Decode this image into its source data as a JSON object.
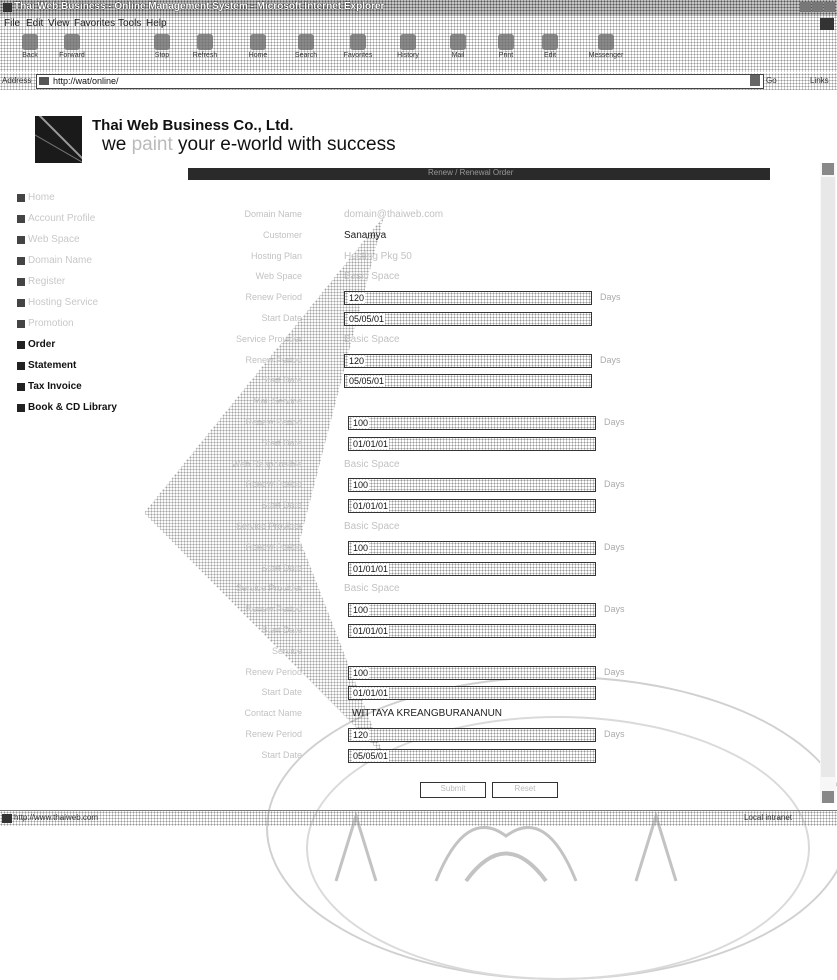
{
  "window": {
    "title": "Thai Web Business - Online Management System - Microsoft Internet Explorer"
  },
  "menu": [
    "File",
    "Edit",
    "View",
    "Favorites",
    "Tools",
    "Help"
  ],
  "toolbar": [
    {
      "label": "Back",
      "icon": "back-arrow-icon"
    },
    {
      "label": "Forward",
      "icon": "forward-arrow-icon"
    },
    {
      "label": "Stop",
      "icon": "stop-icon"
    },
    {
      "label": "Refresh",
      "icon": "refresh-icon"
    },
    {
      "label": "Home",
      "icon": "home-icon"
    },
    {
      "label": "Search",
      "icon": "search-icon"
    },
    {
      "label": "Favorites",
      "icon": "favorites-icon"
    },
    {
      "label": "History",
      "icon": "history-icon"
    },
    {
      "label": "Mail",
      "icon": "mail-icon"
    },
    {
      "label": "Print",
      "icon": "print-icon"
    },
    {
      "label": "Edit",
      "icon": "edit-icon"
    },
    {
      "label": "Messenger",
      "icon": "messenger-icon"
    }
  ],
  "address": {
    "label": "Address",
    "url": "http://wat/online/",
    "go": "Go",
    "links": "Links"
  },
  "brand": {
    "company": "Thai Web Business Co., Ltd.",
    "slogan_before": "we ",
    "slogan_faded": "paint",
    "slogan_after": " your e-world with success"
  },
  "header_bar_text": "Renew / Renewal Order",
  "sidebar": [
    {
      "label": "Home",
      "faded": true
    },
    {
      "label": "Account Profile",
      "faded": true
    },
    {
      "label": "Web Space",
      "faded": true
    },
    {
      "label": "Domain Name",
      "faded": true
    },
    {
      "label": "Register",
      "faded": true
    },
    {
      "label": "Hosting Service",
      "faded": true
    },
    {
      "label": "Promotion",
      "faded": true
    },
    {
      "label": "Order",
      "faded": false
    },
    {
      "label": "Statement",
      "faded": false
    },
    {
      "label": "Tax Invoice",
      "faded": false
    },
    {
      "label": "Book & CD Library",
      "faded": false
    }
  ],
  "form": {
    "rows": [
      {
        "label": "Domain Name",
        "value": "domain@thaiweb.com",
        "faded": true
      },
      {
        "label": "Customer",
        "value": "Sanamya"
      },
      {
        "label": "Hosting Plan",
        "value": "Hosting Pkg 50",
        "faded": true
      },
      {
        "label": "Web Space",
        "value": "Basic Space",
        "faded": true
      },
      {
        "label": "Renew Period",
        "input": "120",
        "unit": "Days"
      },
      {
        "label": "Start Date",
        "input": "05/05/01"
      },
      {
        "label": "Service Provider",
        "value": "Basic Space",
        "faded": true
      },
      {
        "label": "Renew Period",
        "input": "120",
        "unit": "Days"
      },
      {
        "label": "Start Date",
        "input": "05/05/01"
      },
      {
        "label": "Mail Service",
        "value": "",
        "faded": true
      },
      {
        "label": "Renew Period",
        "input": "100",
        "unit": "Days"
      },
      {
        "label": "Start Date",
        "input": "01/01/01"
      },
      {
        "label": "Web Responsible",
        "value": "Basic Space",
        "faded": true
      },
      {
        "label": "Renew Period",
        "input": "100",
        "unit": "Days"
      },
      {
        "label": "Start Date",
        "input": "01/01/01"
      },
      {
        "label": "Service Provider",
        "value": "Basic Space",
        "faded": true
      },
      {
        "label": "Renew Period",
        "input": "100",
        "unit": "Days"
      },
      {
        "label": "Start Date",
        "input": "01/01/01"
      },
      {
        "label": "Service Provider",
        "value": "Basic Space",
        "faded": true
      },
      {
        "label": "Renew Period",
        "input": "100",
        "unit": "Days"
      },
      {
        "label": "Start Date",
        "input": "01/01/01"
      },
      {
        "label": "Service",
        "value": "",
        "faded": true
      },
      {
        "label": "Renew Period",
        "input": "100",
        "unit": "Days"
      },
      {
        "label": "Start Date",
        "input": "01/01/01"
      },
      {
        "label": "Contact Name",
        "value": "WITTAYA KREANGBURANANUN"
      },
      {
        "label": "Renew Period",
        "input": "120",
        "unit": "Days"
      },
      {
        "label": "Start Date",
        "input": "05/05/01"
      }
    ],
    "buttons": {
      "submit": "Submit",
      "reset": "Reset"
    }
  },
  "status": {
    "text": "http://www.thaiweb.com",
    "zone": "Local intranet"
  }
}
